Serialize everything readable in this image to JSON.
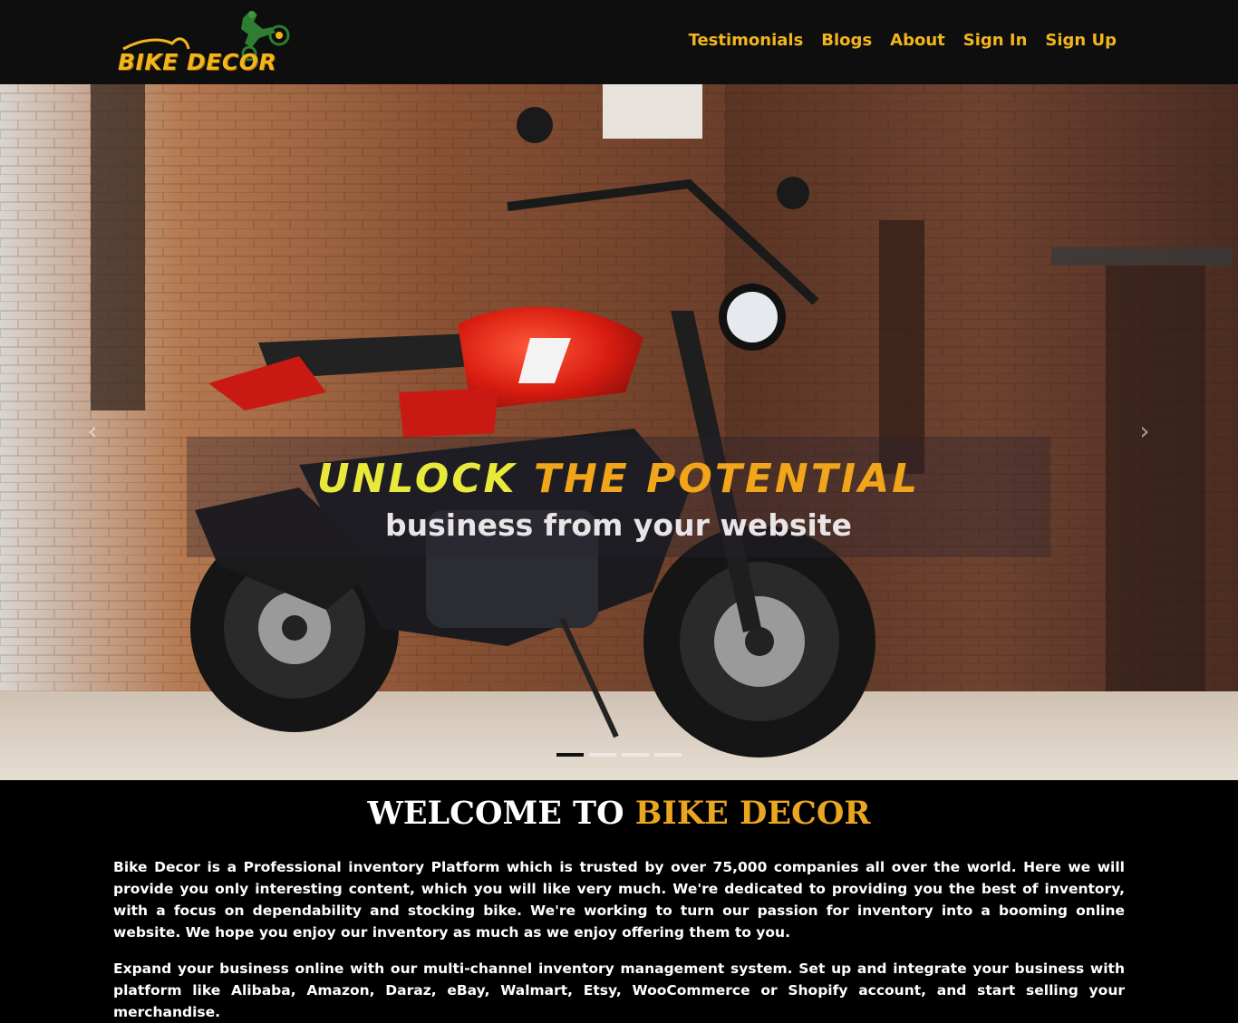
{
  "brand": {
    "name": "BIKE DECOR",
    "color": "#f3b51c"
  },
  "nav": {
    "links": [
      "Testimonials",
      "Blogs",
      "About",
      "Sign In",
      "Sign Up"
    ]
  },
  "hero": {
    "title_part1": "UNLOCK",
    "title_part2": "THE POTENTIAL",
    "subtitle": "business from your website",
    "prev_icon": "chevron-left-icon",
    "next_icon": "chevron-right-icon",
    "slides_count": 4,
    "active_slide": 1,
    "colors": {
      "title1": "#e8e93b",
      "title2": "#f0a51a"
    }
  },
  "welcome": {
    "title_white": "WELCOME TO",
    "title_gold": "BIKE DECOR",
    "paragraph1": "Bike Decor is a Professional inventory Platform which is trusted by over 75,000 companies all over the world. Here we will provide you only interesting content, which you will like very much. We're dedicated to providing you the best of inventory, with a focus on dependability and stocking bike. We're working to turn our passion for inventory into a booming online website. We hope you enjoy our inventory as much as we enjoy offering them to you.",
    "paragraph2": "Expand your business online with our multi-channel inventory management system. Set up and integrate your business with platform like Alibaba, Amazon, Daraz, eBay, Walmart, Etsy, WooCommerce or Shopify account, and start selling your merchandise."
  }
}
